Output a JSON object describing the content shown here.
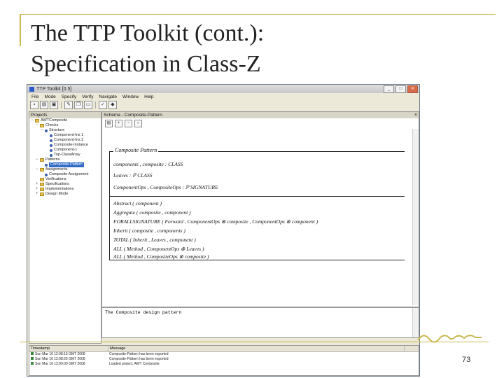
{
  "slide": {
    "title_line1": "The TTP Toolkit (cont.):",
    "title_line2": "Specification in Class-Z",
    "page_number": "73"
  },
  "window": {
    "title": "TTP Toolkit [0.5]",
    "minimize": "_",
    "maximize": "□",
    "close": "✕"
  },
  "menu": [
    "File",
    "Mode",
    "Specify",
    "Verify",
    "Navigate",
    "Window",
    "Help"
  ],
  "left_pane": {
    "header": "Projects",
    "items": [
      {
        "label": "AWTComposite",
        "indent": 0,
        "icon": "folder",
        "expander": "−"
      },
      {
        "label": "Checks",
        "indent": 1,
        "icon": "folder",
        "expander": "−"
      },
      {
        "label": "Structure",
        "indent": 2,
        "icon": "bullet",
        "expander": "−"
      },
      {
        "label": "Component-Ins 1",
        "indent": 3,
        "icon": "bullet",
        "expander": ""
      },
      {
        "label": "Component-Ins 2",
        "indent": 3,
        "icon": "bullet",
        "expander": ""
      },
      {
        "label": "Composite-Instance",
        "indent": 3,
        "icon": "bullet",
        "expander": ""
      },
      {
        "label": "Component-1",
        "indent": 3,
        "icon": "bullet",
        "expander": ""
      },
      {
        "label": "Top-ClassArray",
        "indent": 3,
        "icon": "bullet",
        "expander": ""
      },
      {
        "label": "Patterns",
        "indent": 1,
        "icon": "folder",
        "expander": "−"
      },
      {
        "label": "Composite-Pattern",
        "indent": 2,
        "icon": "bullet",
        "expander": "",
        "selected": true
      },
      {
        "label": "Assignments",
        "indent": 1,
        "icon": "folder",
        "expander": "−"
      },
      {
        "label": "Composite Assignment",
        "indent": 2,
        "icon": "bullet",
        "expander": ""
      },
      {
        "label": "Verifications",
        "indent": 1,
        "icon": "folder",
        "expander": ""
      },
      {
        "label": "Specifications",
        "indent": 1,
        "icon": "folder",
        "expander": "+"
      },
      {
        "label": "Implementations",
        "indent": 1,
        "icon": "folder",
        "expander": "+"
      },
      {
        "label": "Design Mode",
        "indent": 1,
        "icon": "folder",
        "expander": "+"
      }
    ]
  },
  "schema_pane": {
    "header": "Schema - Composite-Pattern",
    "close": "×",
    "box_name": "Composite Pattern",
    "declarations": [
      "components , composite : CLASS",
      "Leaves : ℙ CLASS",
      "ComponentOps , CompositeOps : ℙ SIGNATURE"
    ],
    "predicates": [
      "Abstract ( component )",
      "Aggregate ( composite , component )",
      "FORALLSIGNATURE ( Forward , ComponentOps ⊗ composite , ComponentOps ⊗ component )",
      "Inherit ( composite , components )",
      "TOTAL ( Inherit , Leaves , component )",
      "ALL ( Method , ComponentOps ⊗ Leaves )",
      "ALL ( Method , CompositeOps ⊗ composite )"
    ]
  },
  "description_pane": {
    "text": "The Composite design pattern"
  },
  "log": {
    "col_time": "Timestamp",
    "col_message": "Message",
    "rows": [
      {
        "time": "Sun Mar 16 12:08:15 GMT 2008",
        "message": "Composite-Pattern has been exported"
      },
      {
        "time": "Sun Mar 16 12:08:25 GMT 2008",
        "message": "Composite-Pattern has been exported"
      },
      {
        "time": "Sun Mar 16 12:09:00 GMT 2008",
        "message": "Loaded project: AWT Composite"
      }
    ]
  },
  "colors": {
    "accent_gold": "#c8b850",
    "selection": "#316ac5"
  }
}
